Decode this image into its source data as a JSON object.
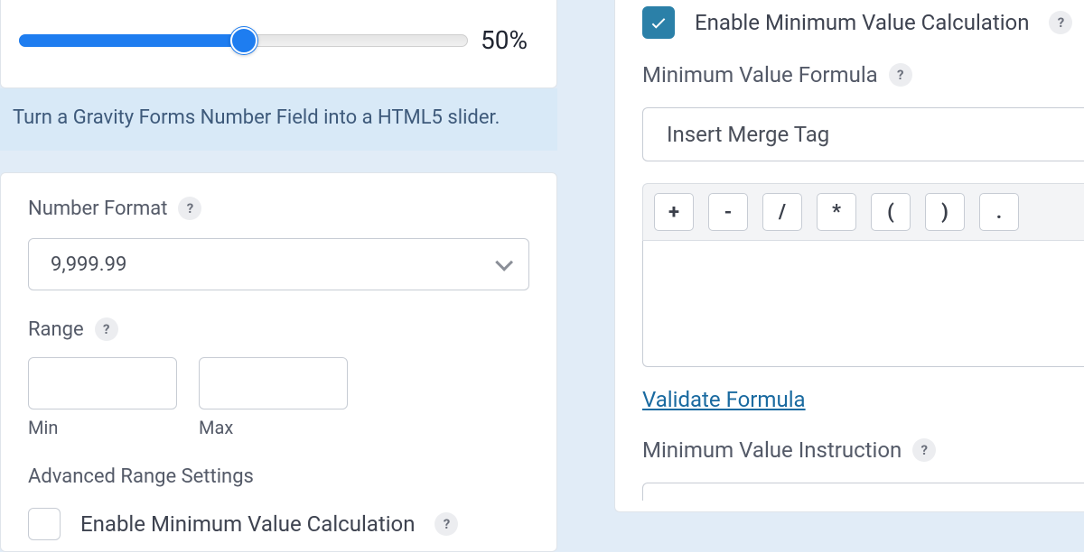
{
  "slider": {
    "value_display": "50%",
    "percent": 50
  },
  "caption": "Turn a Gravity Forms Number Field into a HTML5 slider.",
  "number_format": {
    "label": "Number Format",
    "selected": "9,999.99"
  },
  "range": {
    "label": "Range",
    "min_label": "Min",
    "max_label": "Max",
    "min_value": "",
    "max_value": ""
  },
  "advanced": {
    "heading": "Advanced Range Settings",
    "enable_min_calc_label": "Enable Minimum Value Calculation",
    "enable_min_calc_left_checked": false,
    "enable_min_calc_right_checked": true
  },
  "formula": {
    "label": "Minimum Value Formula",
    "merge_tag_placeholder": "Insert Merge Tag",
    "operators": [
      "+",
      "-",
      "/",
      "*",
      "(",
      ")",
      "."
    ],
    "textarea_value": "",
    "validate_link": "Validate Formula"
  },
  "instruction": {
    "label": "Minimum Value Instruction"
  },
  "help_glyph": "?"
}
